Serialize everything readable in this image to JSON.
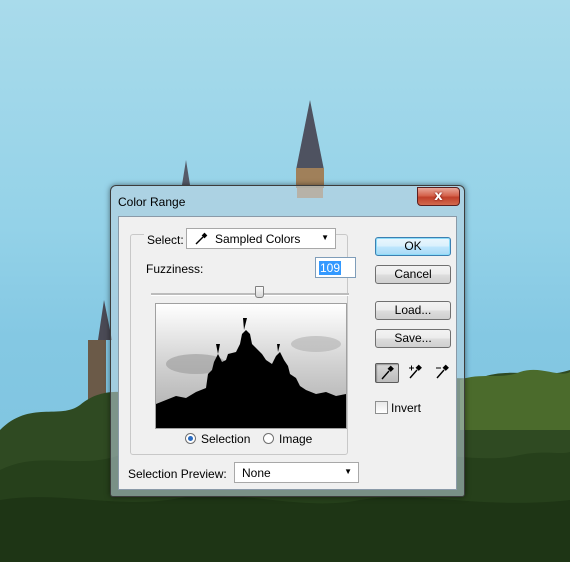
{
  "dialog": {
    "title": "Color Range",
    "close_label": "x",
    "select_label": "Select:",
    "select_value": "Sampled Colors",
    "fuzziness_label": "Fuzziness:",
    "fuzziness_value": "109",
    "fuzziness_slider_value": 109,
    "radio_selection_label": "Selection",
    "radio_image_label": "Image",
    "radio_selected": "Selection",
    "selection_preview_label": "Selection Preview:",
    "selection_preview_value": "None",
    "ok_label": "OK",
    "cancel_label": "Cancel",
    "load_label": "Load...",
    "save_label": "Save...",
    "invert_label": "Invert",
    "invert_checked": false,
    "tools": [
      "eyedropper-icon",
      "eyedropper-plus-icon",
      "eyedropper-minus-icon"
    ],
    "active_tool": "eyedropper-icon"
  },
  "colors": {
    "sky": "#8ccfe6",
    "close_button": "#c8452e",
    "default_button_border": "#3c7fb1",
    "selection_highlight": "#3399ff"
  }
}
